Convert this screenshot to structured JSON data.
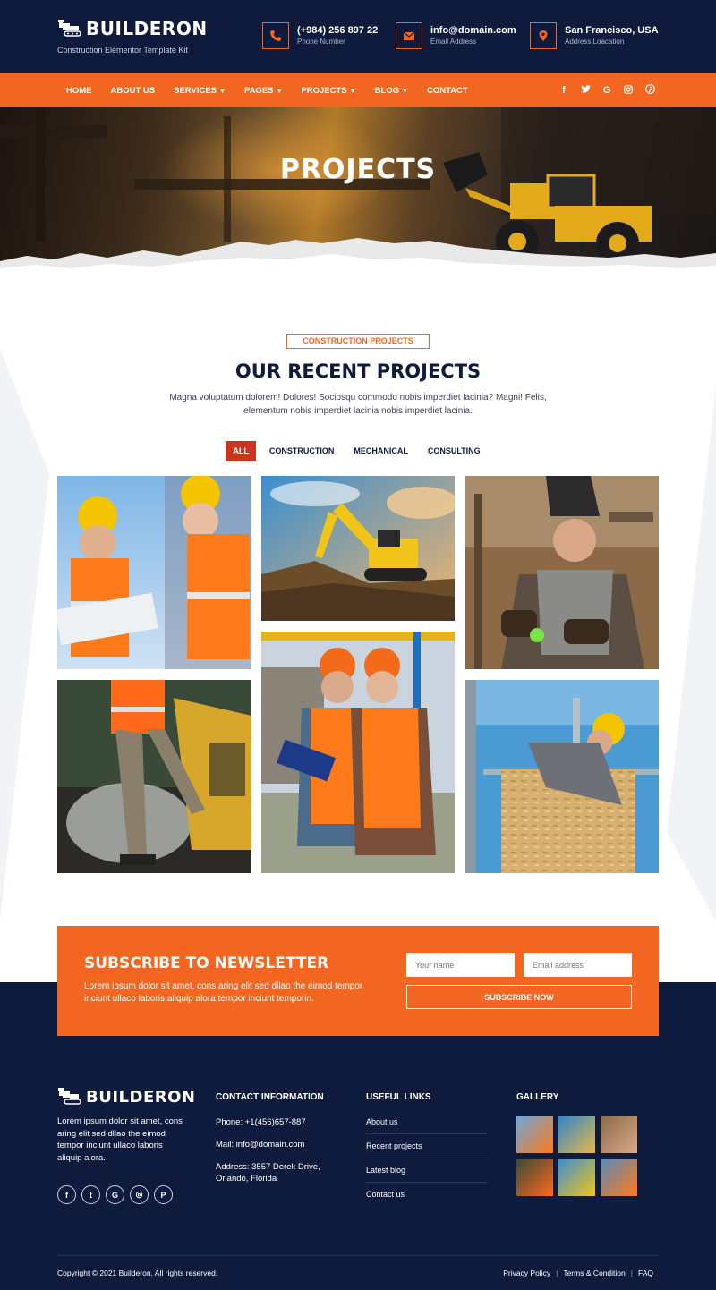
{
  "brand": {
    "name": "BUILDERON",
    "tagline": "Construction Elementor Template Kit"
  },
  "header_contacts": [
    {
      "icon": "phone-icon",
      "main": "(+984) 256 897 22",
      "sub": "Phone Number"
    },
    {
      "icon": "mail-icon",
      "main": "info@domain.com",
      "sub": "Email Address"
    },
    {
      "icon": "location-pin-icon",
      "main": "San Francisco, USA",
      "sub": "Address Loacation"
    }
  ],
  "nav": {
    "items": [
      {
        "label": "HOME",
        "dropdown": false
      },
      {
        "label": "ABOUT US",
        "dropdown": false
      },
      {
        "label": "SERVICES",
        "dropdown": true
      },
      {
        "label": "PAGES",
        "dropdown": true
      },
      {
        "label": "PROJECTS",
        "dropdown": true
      },
      {
        "label": "BLOG",
        "dropdown": true
      },
      {
        "label": "CONTACT",
        "dropdown": false
      }
    ],
    "social": [
      "facebook-icon",
      "twitter-icon",
      "google-icon",
      "instagram-icon",
      "pinterest-icon"
    ]
  },
  "hero": {
    "title": "PROJECTS"
  },
  "projects": {
    "tag": "CONSTRUCTION PROJECTS",
    "title": "OUR RECENT PROJECTS",
    "description": "Magna voluptatum dolorem! Dolores! Sociosqu commodo nobis imperdiet lacinia? Magni! Felis, elementum nobis imperdiet lacinia nobis imperdiet lacinia.",
    "filters": [
      "ALL",
      "CONSTRUCTION",
      "MECHANICAL",
      "CONSULTING"
    ],
    "active_filter": "ALL"
  },
  "newsletter": {
    "title": "SUBSCRIBE TO NEWSLETTER",
    "description": "Lorem ipsum dolor sit amet, cons aring elit sed dllao the eimod tempor inciunt ullaco laboris aliquip alora tempor inciunt temporin.",
    "name_placeholder": "Your name",
    "email_placeholder": "Email address",
    "button": "SUBSCRIBE NOW"
  },
  "footer": {
    "about": "Lorem ipsum dolor sit amet, cons aring elit sed dllao the eimod tempor inciunt ullaco laboris aliquip alora.",
    "contact_heading": "CONTACT INFORMATION",
    "phone": "Phone: +1(456)657-887",
    "mail": "Mail: info@domain.com",
    "address": "Address: 3557 Derek Drive, Orlando, Florida",
    "links_heading": "USEFUL LINKS",
    "links": [
      "About us",
      "Recent projects",
      "Latest blog",
      "Contact us"
    ],
    "gallery_heading": "GALLERY",
    "copyright": "Copyright © 2021 Builderon. All rights reserved.",
    "legal": [
      "Privacy Policy",
      "Terms & Condition",
      "FAQ"
    ]
  },
  "colors": {
    "navy": "#0f1b3d",
    "orange": "#f26622",
    "active_filter": "#c6371d"
  }
}
